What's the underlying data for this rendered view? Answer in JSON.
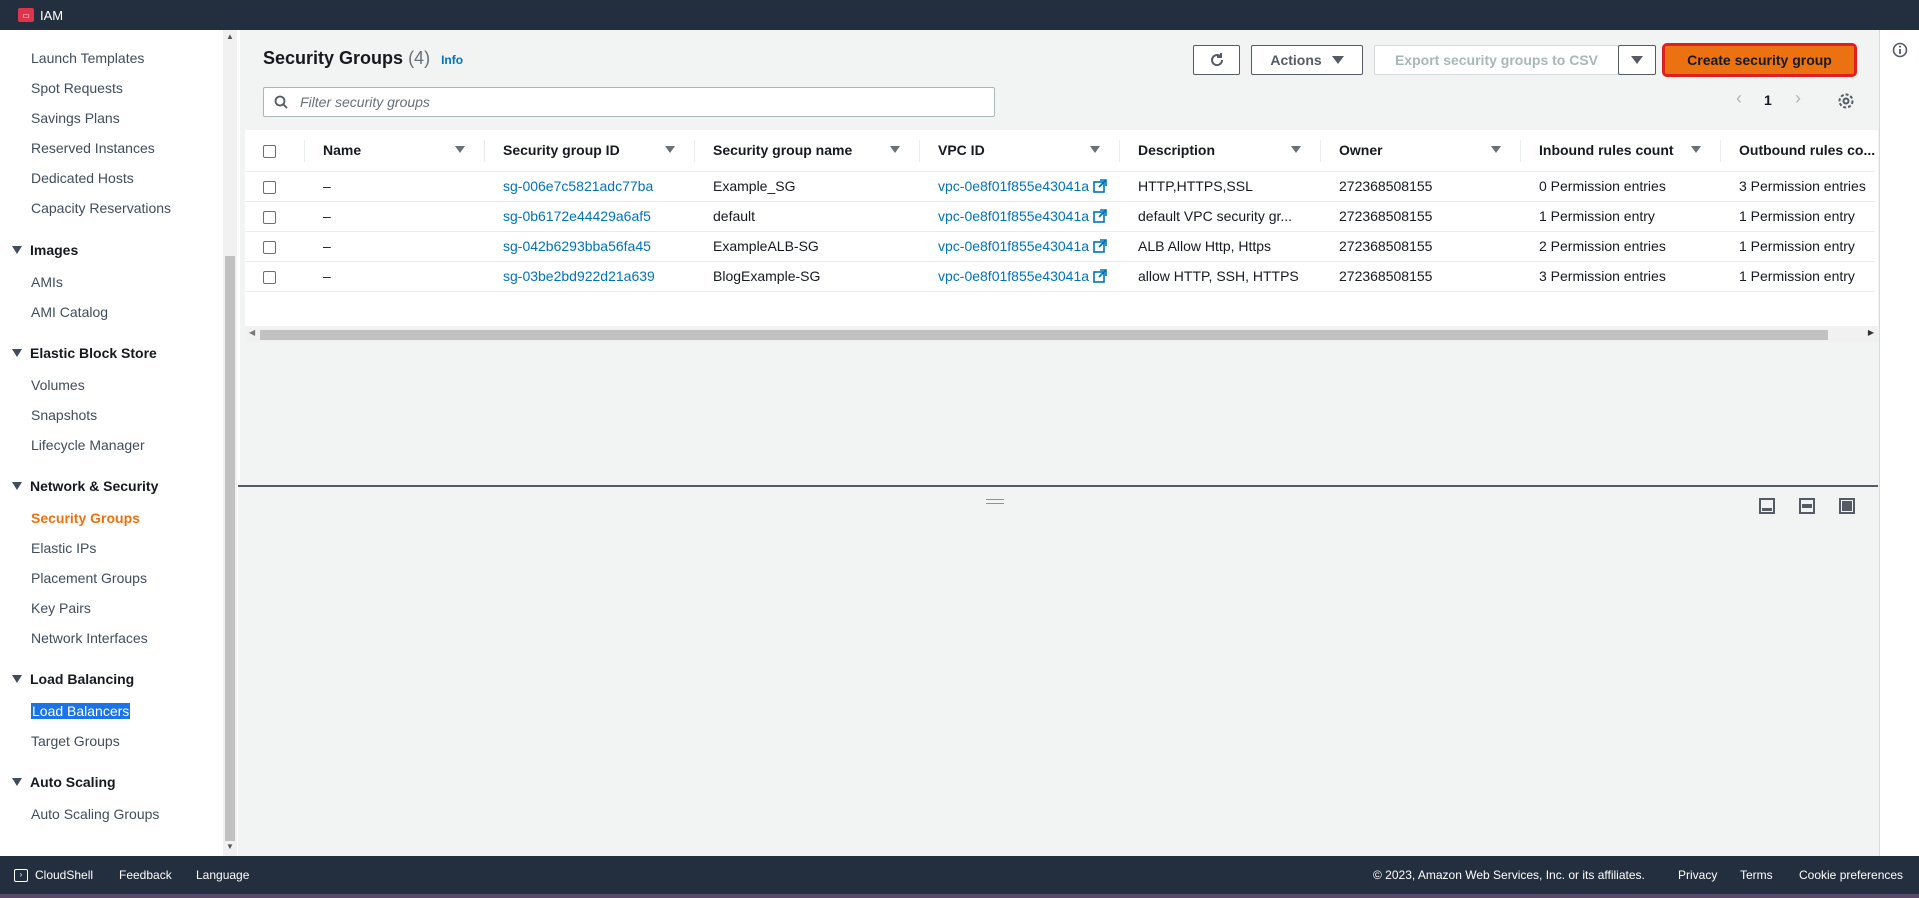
{
  "topbar": {
    "service": "IAM"
  },
  "sidebar": {
    "items": [
      {
        "kind": "item",
        "label": "Launch Templates"
      },
      {
        "kind": "item",
        "label": "Spot Requests"
      },
      {
        "kind": "item",
        "label": "Savings Plans"
      },
      {
        "kind": "item",
        "label": "Reserved Instances"
      },
      {
        "kind": "item",
        "label": "Dedicated Hosts"
      },
      {
        "kind": "item",
        "label": "Capacity Reservations"
      },
      {
        "kind": "group",
        "label": "Images"
      },
      {
        "kind": "item",
        "label": "AMIs"
      },
      {
        "kind": "item",
        "label": "AMI Catalog"
      },
      {
        "kind": "group",
        "label": "Elastic Block Store"
      },
      {
        "kind": "item",
        "label": "Volumes"
      },
      {
        "kind": "item",
        "label": "Snapshots"
      },
      {
        "kind": "item",
        "label": "Lifecycle Manager"
      },
      {
        "kind": "group",
        "label": "Network & Security"
      },
      {
        "kind": "item",
        "label": "Security Groups",
        "state": "active"
      },
      {
        "kind": "item",
        "label": "Elastic IPs"
      },
      {
        "kind": "item",
        "label": "Placement Groups"
      },
      {
        "kind": "item",
        "label": "Key Pairs"
      },
      {
        "kind": "item",
        "label": "Network Interfaces"
      },
      {
        "kind": "group",
        "label": "Load Balancing"
      },
      {
        "kind": "item",
        "label": "Load Balancers",
        "state": "selected"
      },
      {
        "kind": "item",
        "label": "Target Groups"
      },
      {
        "kind": "group",
        "label": "Auto Scaling"
      },
      {
        "kind": "item",
        "label": "Auto Scaling Groups"
      }
    ]
  },
  "header": {
    "title": "Security Groups",
    "count": "(4)",
    "info": "Info",
    "actions_label": "Actions",
    "export_label": "Export security groups to CSV",
    "create_label": "Create security group"
  },
  "search": {
    "placeholder": "Filter security groups"
  },
  "pagination": {
    "page": "1"
  },
  "table": {
    "columns": [
      "Name",
      "Security group ID",
      "Security group name",
      "VPC ID",
      "Description",
      "Owner",
      "Inbound rules count",
      "Outbound rules co..."
    ],
    "rows": [
      {
        "name": "–",
        "id": "sg-006e7c5821adc77ba",
        "sgname": "Example_SG",
        "vpc": "vpc-0e8f01f855e43041a",
        "desc": "HTTP,HTTPS,SSL",
        "owner": "272368508155",
        "inbound": "0 Permission entries",
        "outbound": "3 Permission entries"
      },
      {
        "name": "–",
        "id": "sg-0b6172e44429a6af5",
        "sgname": "default",
        "vpc": "vpc-0e8f01f855e43041a",
        "desc": "default VPC security gr...",
        "owner": "272368508155",
        "inbound": "1 Permission entry",
        "outbound": "1 Permission entry"
      },
      {
        "name": "–",
        "id": "sg-042b6293bba56fa45",
        "sgname": "ExampleALB-SG",
        "vpc": "vpc-0e8f01f855e43041a",
        "desc": "ALB Allow Http, Https",
        "owner": "272368508155",
        "inbound": "2 Permission entries",
        "outbound": "1 Permission entry"
      },
      {
        "name": "–",
        "id": "sg-03be2bd922d21a639",
        "sgname": "BlogExample-SG",
        "vpc": "vpc-0e8f01f855e43041a",
        "desc": "allow HTTP, SSH, HTTPS",
        "owner": "272368508155",
        "inbound": "3 Permission entries",
        "outbound": "1 Permission entry"
      }
    ]
  },
  "footer": {
    "cloudshell": "CloudShell",
    "feedback": "Feedback",
    "language": "Language",
    "copyright": "© 2023, Amazon Web Services, Inc. or its affiliates.",
    "privacy": "Privacy",
    "terms": "Terms",
    "cookies": "Cookie preferences"
  },
  "colors": {
    "accent": "#ec7211",
    "link": "#0073bb",
    "topbar": "#232f3e",
    "highlight": "#e02020"
  }
}
